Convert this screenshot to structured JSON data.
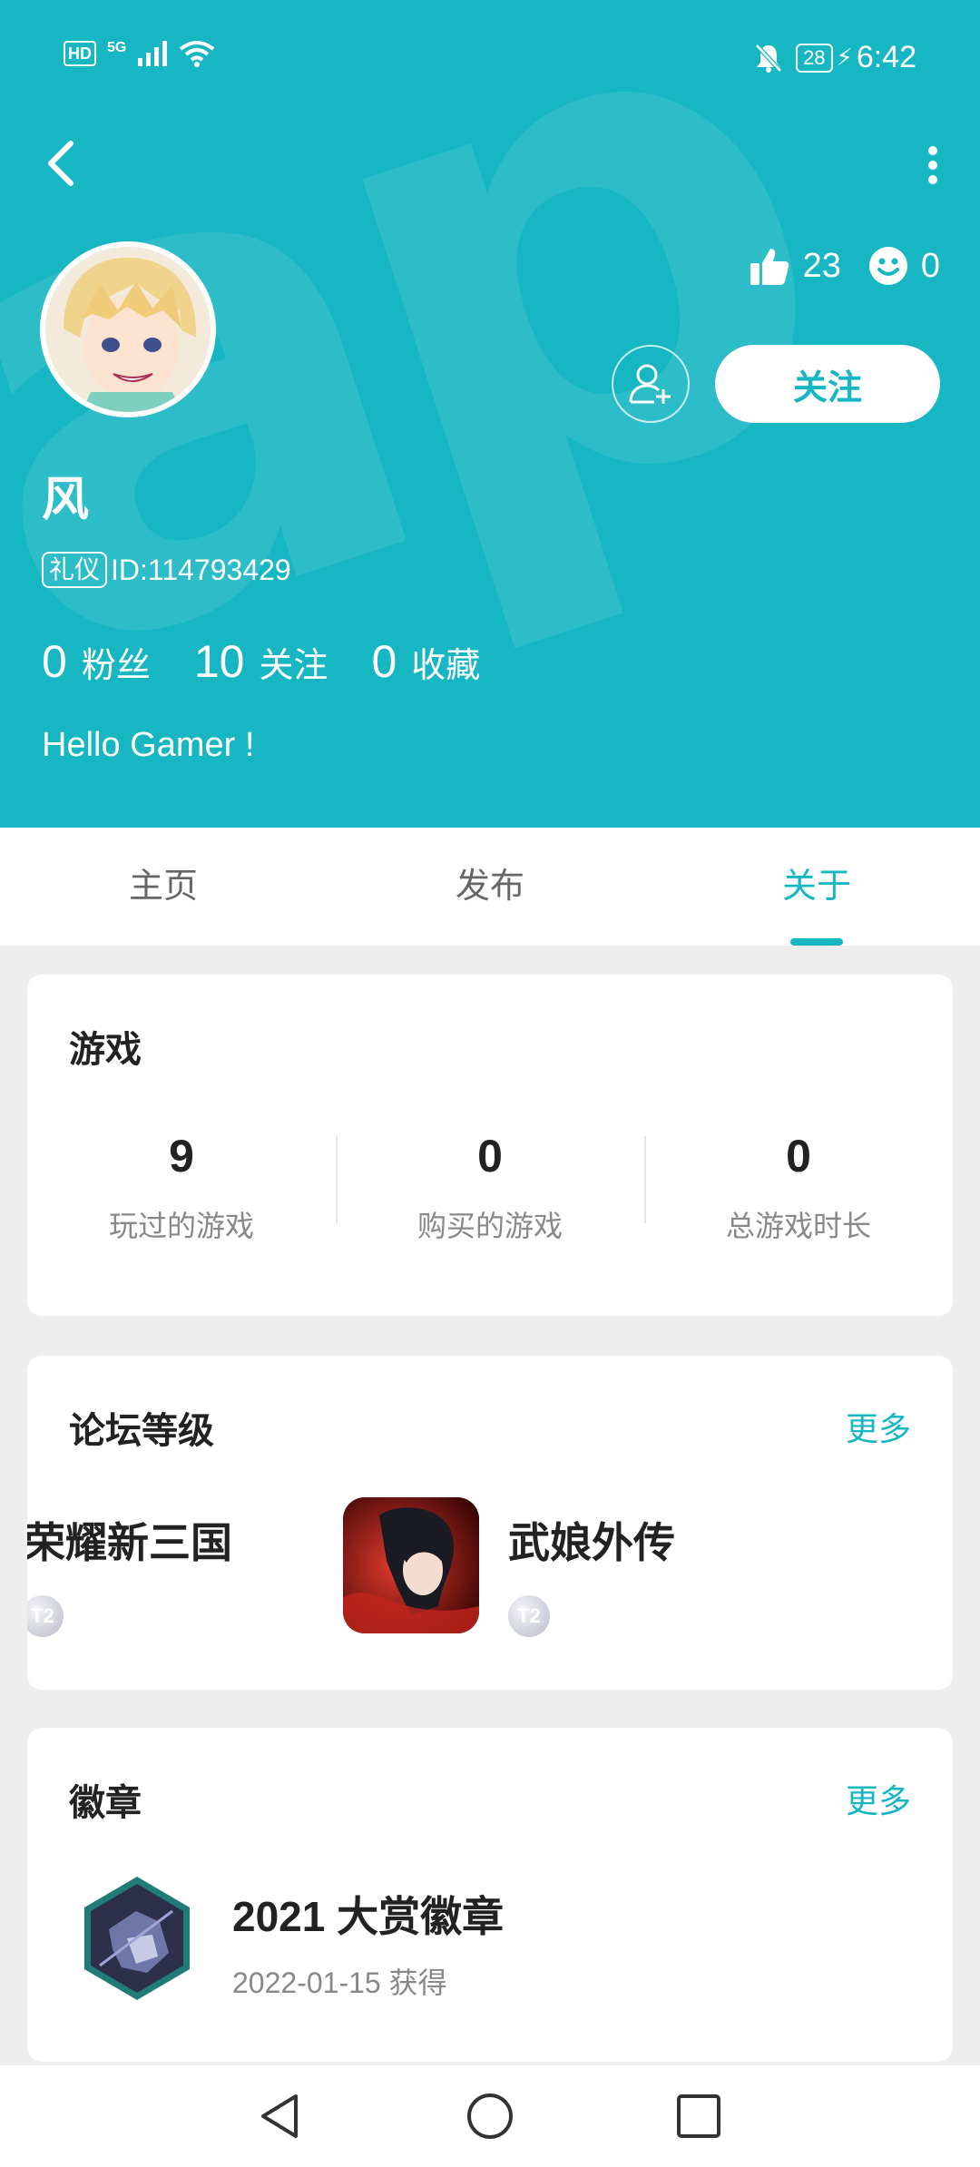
{
  "status_bar": {
    "left_label": "HD",
    "network": "5G",
    "battery": "28",
    "time": "6:42"
  },
  "profile": {
    "likes": "23",
    "reactions": "0",
    "follow_label": "关注",
    "username": "风",
    "badge_tag": "礼仪",
    "id_text": "ID:114793429",
    "counts": [
      {
        "num": "0",
        "label": "粉丝"
      },
      {
        "num": "10",
        "label": "关注"
      },
      {
        "num": "0",
        "label": "收藏"
      }
    ],
    "bio": "Hello Gamer !"
  },
  "tabs": [
    "主页",
    "发布",
    "关于"
  ],
  "active_tab": 2,
  "games_card": {
    "title": "游戏",
    "stats": [
      {
        "value": "9",
        "label": "玩过的游戏"
      },
      {
        "value": "0",
        "label": "购买的游戏"
      },
      {
        "value": "0",
        "label": "总游戏时长"
      }
    ]
  },
  "forum_card": {
    "title": "论坛等级",
    "more": "更多",
    "items": [
      {
        "name": "荣耀新三国",
        "level": "T2"
      },
      {
        "name": "武娘外传",
        "level": "T2"
      }
    ]
  },
  "badges_card": {
    "title": "徽章",
    "more": "更多",
    "badge_name": "2021 大赏徽章",
    "badge_date": "2022-01-15 获得"
  },
  "colors": {
    "accent": "#16b6c3",
    "background": "#eeeeee"
  }
}
